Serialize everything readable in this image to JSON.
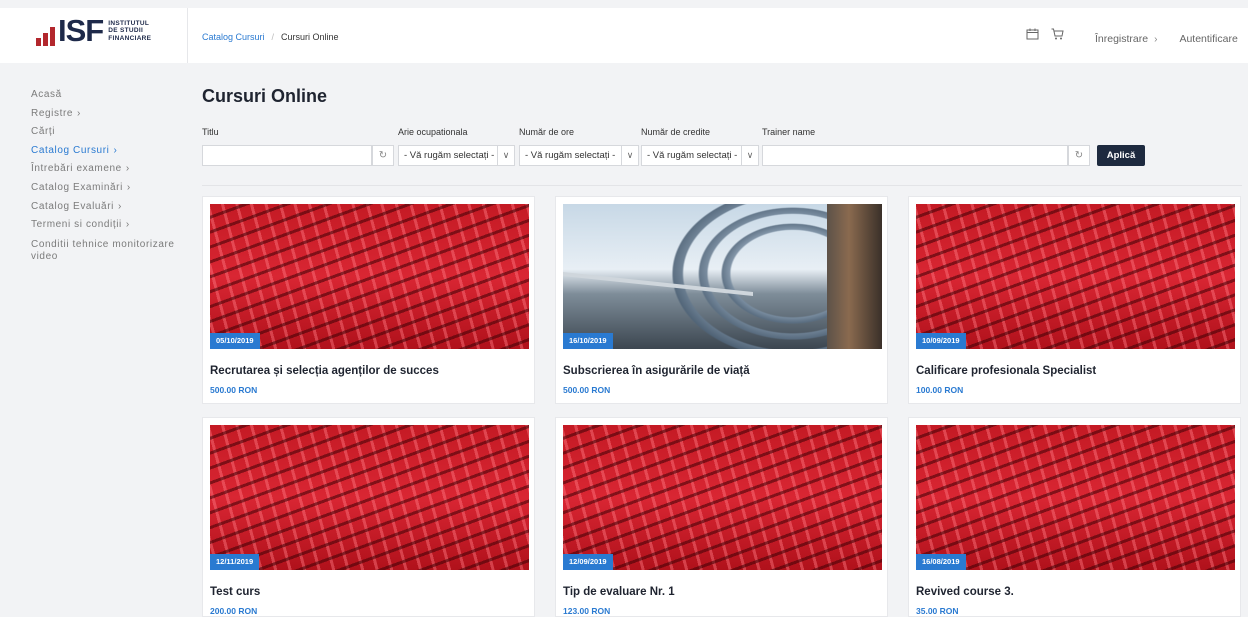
{
  "header": {
    "logo": {
      "letters": "ISF",
      "subtitle_lines": [
        "INSTITUTUL",
        "DE STUDII",
        "FINANCIARE"
      ]
    },
    "breadcrumb": [
      {
        "label": "Catalog Cursuri"
      },
      {
        "label": "Cursuri Online"
      }
    ],
    "breadcrumb_separator": "/",
    "icons": [
      "calendar-icon",
      "cart-icon"
    ],
    "nav": [
      {
        "label": "Înregistrare",
        "chevron": "›"
      },
      {
        "label": "Autentificare"
      }
    ]
  },
  "sidebar": {
    "items": [
      {
        "label": "Acasă",
        "chevron": ""
      },
      {
        "label": "Registre",
        "chevron": "›"
      },
      {
        "label": "Cărți",
        "chevron": ""
      },
      {
        "label": "Catalog Cursuri",
        "chevron": "›",
        "active": true
      },
      {
        "label": "Întrebări examene",
        "chevron": "›"
      },
      {
        "label": "Catalog Examinări",
        "chevron": "›"
      },
      {
        "label": "Catalog Evaluări",
        "chevron": "›"
      },
      {
        "label": "Termeni si condiții",
        "chevron": "›"
      },
      {
        "label": "Conditii tehnice monitorizare video",
        "chevron": ""
      }
    ]
  },
  "main": {
    "title": "Cursuri Online",
    "filters": {
      "title_label": "Titlu",
      "title_value": "",
      "area_label": "Arie ocupationala",
      "area_value": "- Vă rugăm selectați -",
      "hours_label": "Număr de ore",
      "hours_value": "- Vă rugăm selectați -",
      "credits_label": "Număr de credite",
      "credits_value": "- Vă rugăm selectați -",
      "trainer_label": "Trainer name",
      "trainer_value": "",
      "apply_label": "Aplică"
    },
    "courses": [
      {
        "date": "05/10/2019",
        "title": "Recrutarea și selecția agenților de succes",
        "price": "500.00 RON",
        "image": "stadium-seats"
      },
      {
        "date": "16/10/2019",
        "title": "Subscrierea în asigurările de viață",
        "price": "500.00 RON",
        "image": "arch-corridor"
      },
      {
        "date": "10/09/2019",
        "title": "Calificare profesionala Specialist",
        "price": "100.00 RON",
        "image": "stadium-seats"
      },
      {
        "date": "12/11/2019",
        "title": "Test curs",
        "price": "200.00 RON",
        "image": "stadium-seats"
      },
      {
        "date": "12/09/2019",
        "title": "Tip de evaluare Nr. 1",
        "price": "123.00 RON",
        "image": "stadium-seats"
      },
      {
        "date": "16/08/2019",
        "title": "Revived course 3.",
        "price": "35.00 RON",
        "image": "stadium-seats"
      }
    ]
  },
  "colors": {
    "accent": "#2a7ad1",
    "button_dark": "#1e2a3f",
    "logo_red": "#b3272d",
    "logo_navy": "#1e2a4a"
  }
}
